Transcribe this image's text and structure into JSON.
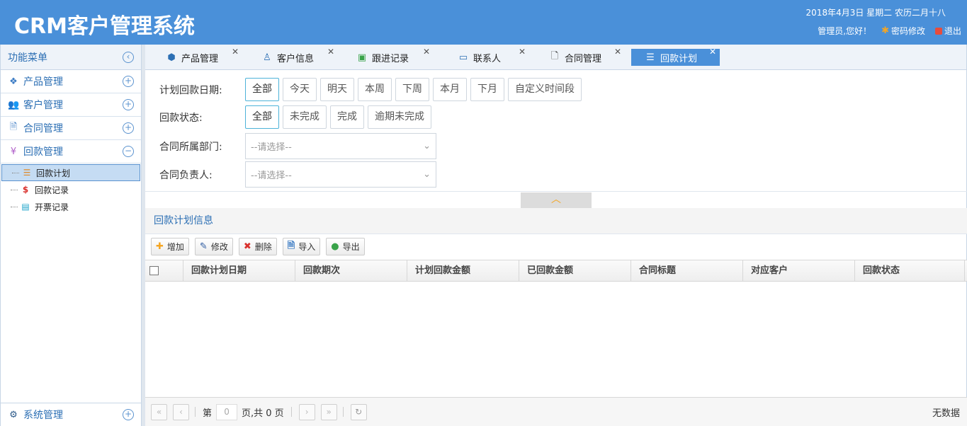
{
  "header": {
    "title": "CRM客户管理系统",
    "date": "2018年4月3日 星期二 农历二月十八",
    "greeting": "管理员,您好！",
    "password_label": "密码修改",
    "logout_label": "退出"
  },
  "sidebar": {
    "title": "功能菜单",
    "items": [
      {
        "label": "产品管理",
        "icon": "cubes-icon",
        "expanded": false
      },
      {
        "label": "客户管理",
        "icon": "users-icon",
        "expanded": false
      },
      {
        "label": "合同管理",
        "icon": "contract-icon",
        "expanded": false
      },
      {
        "label": "回款管理",
        "icon": "yen-icon",
        "expanded": true
      }
    ],
    "sub_items": [
      {
        "label": "回款计划",
        "icon": "list-icon",
        "active": true
      },
      {
        "label": "回款记录",
        "icon": "dollar-icon",
        "active": false
      },
      {
        "label": "开票记录",
        "icon": "invoice-icon",
        "active": false
      }
    ],
    "bottom": {
      "label": "系统管理",
      "icon": "gear-icon"
    }
  },
  "tabs": [
    {
      "label": "产品管理",
      "icon": "cube-icon"
    },
    {
      "label": "客户信息",
      "icon": "user-icon"
    },
    {
      "label": "跟进记录",
      "icon": "followup-icon"
    },
    {
      "label": "联系人",
      "icon": "contact-card-icon"
    },
    {
      "label": "合同管理",
      "icon": "document-icon"
    },
    {
      "label": "回款计划",
      "icon": "list-icon",
      "active": true
    }
  ],
  "filter": {
    "date_label": "计划回款日期:",
    "date_options": [
      "全部",
      "今天",
      "明天",
      "本周",
      "下周",
      "本月",
      "下月",
      "自定义时间段"
    ],
    "status_label": "回款状态:",
    "status_options": [
      "全部",
      "未完成",
      "完成",
      "逾期未完成"
    ],
    "dept_label": "合同所属部门:",
    "dept_placeholder": "--请选择--",
    "owner_label": "合同负责人:",
    "owner_placeholder": "--请选择--"
  },
  "section_title": "回款计划信息",
  "toolbar": {
    "add": "增加",
    "edit": "修改",
    "delete": "删除",
    "import": "导入",
    "export": "导出"
  },
  "table": {
    "columns": [
      "回款计划日期",
      "回款期次",
      "计划回款金额",
      "已回款金额",
      "合同标题",
      "对应客户",
      "回款状态"
    ]
  },
  "pager": {
    "page_prefix": "第",
    "page_value": "0",
    "page_suffix": "页,共 0 页",
    "no_data": "无数据"
  },
  "colors": {
    "header_bg": "#4a90d9",
    "accent": "#2c6fb4",
    "selected_border": "#4db3d9"
  }
}
